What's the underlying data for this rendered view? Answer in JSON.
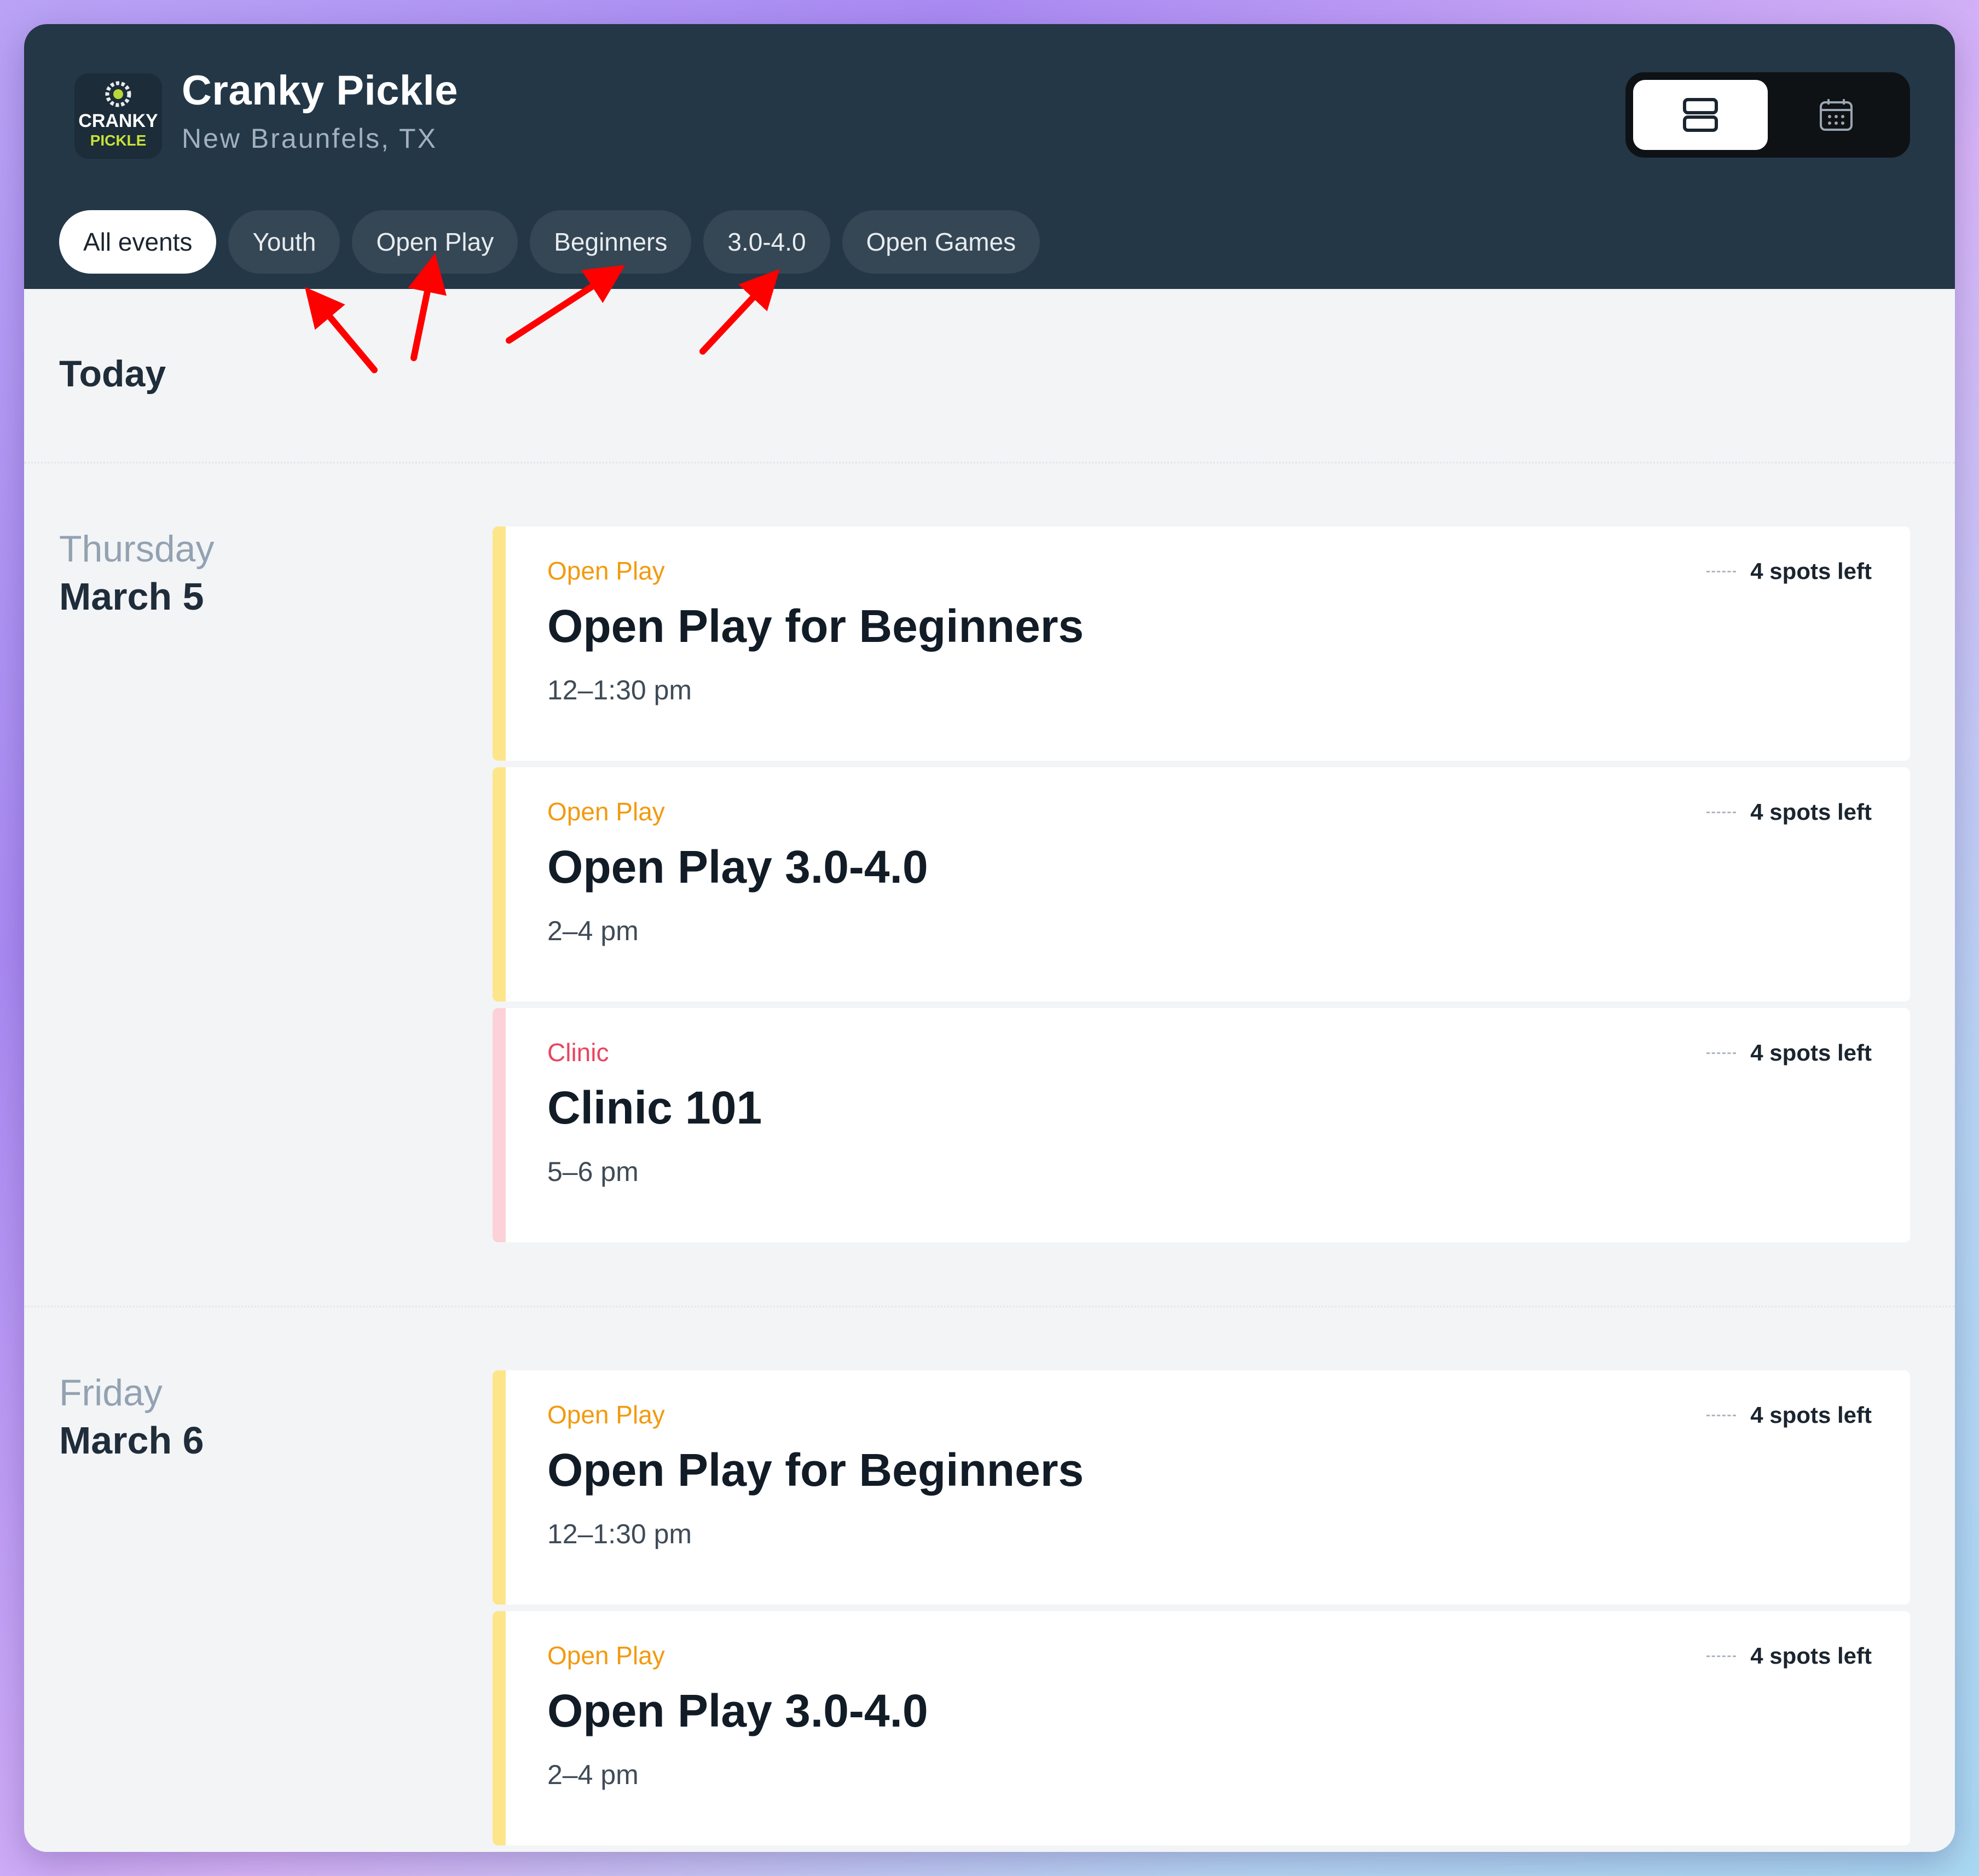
{
  "header": {
    "title": "Cranky Pickle",
    "subtitle": "New Braunfels, TX",
    "logo": {
      "top_text": "CRANKY",
      "bottom_text": "PICKLE"
    }
  },
  "view_toggle": {
    "list_icon": "list-view-icon",
    "calendar_icon": "calendar-icon"
  },
  "filters": [
    {
      "label": "All events",
      "active": true
    },
    {
      "label": "Youth",
      "active": false
    },
    {
      "label": "Open Play",
      "active": false
    },
    {
      "label": "Beginners",
      "active": false
    },
    {
      "label": "3.0-4.0",
      "active": false
    },
    {
      "label": "Open Games",
      "active": false
    }
  ],
  "sections": {
    "today_label": "Today"
  },
  "days": [
    {
      "weekday": "Thursday",
      "date": "March 5",
      "events": [
        {
          "category": "Open Play",
          "title": "Open Play for Beginners",
          "time": "12–1:30 pm",
          "spots": "4 spots left",
          "color": "#fde58a",
          "cat_color": "#f29a0e"
        },
        {
          "category": "Open Play",
          "title": "Open Play 3.0-4.0",
          "time": "2–4 pm",
          "spots": "4 spots left",
          "color": "#fde58a",
          "cat_color": "#f29a0e"
        },
        {
          "category": "Clinic",
          "title": "Clinic 101",
          "time": "5–6 pm",
          "spots": "4 spots left",
          "color": "#fdd1d8",
          "cat_color": "#e9445f"
        }
      ]
    },
    {
      "weekday": "Friday",
      "date": "March 6",
      "events": [
        {
          "category": "Open Play",
          "title": "Open Play for Beginners",
          "time": "12–1:30 pm",
          "spots": "4 spots left",
          "color": "#fde58a",
          "cat_color": "#f29a0e"
        },
        {
          "category": "Open Play",
          "title": "Open Play 3.0-4.0",
          "time": "2–4 pm",
          "spots": "4 spots left",
          "color": "#fde58a",
          "cat_color": "#f29a0e"
        }
      ]
    }
  ],
  "colors": {
    "header_bg": "#233747",
    "pill_bg": "#354654",
    "open_play_accent": "#f29a0e",
    "clinic_accent": "#e9445f",
    "annotation_arrow": "#ff0000"
  }
}
